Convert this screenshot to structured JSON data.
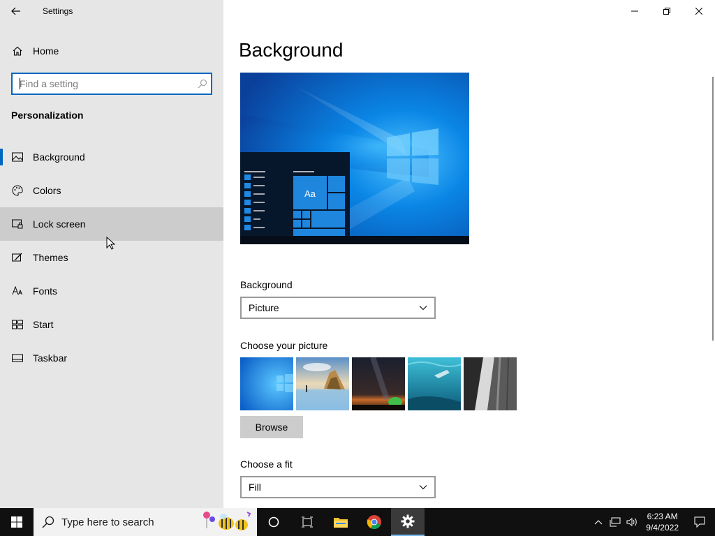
{
  "window": {
    "title": "Settings"
  },
  "sidebar": {
    "home_label": "Home",
    "search_placeholder": "Find a setting",
    "section_title": "Personalization",
    "items": [
      {
        "label": "Background",
        "icon": "picture-icon",
        "active": true
      },
      {
        "label": "Colors",
        "icon": "palette-icon"
      },
      {
        "label": "Lock screen",
        "icon": "lock-screen-icon",
        "hover": true
      },
      {
        "label": "Themes",
        "icon": "themes-brush-icon"
      },
      {
        "label": "Fonts",
        "icon": "fonts-icon"
      },
      {
        "label": "Start",
        "icon": "start-layout-icon"
      },
      {
        "label": "Taskbar",
        "icon": "taskbar-icon"
      }
    ]
  },
  "main": {
    "page_title": "Background",
    "preview_tile_text": "Aa",
    "background_label": "Background",
    "background_value": "Picture",
    "choose_picture_label": "Choose your picture",
    "browse_label": "Browse",
    "choose_fit_label": "Choose a fit",
    "fit_value": "Fill"
  },
  "taskbar": {
    "search_text": "Type here to search",
    "time": "6:23 AM",
    "date": "9/4/2022"
  },
  "colors": {
    "accent": "#0067c0",
    "sidebar_bg": "#e6e6e6",
    "taskbar_bg": "#101010"
  }
}
